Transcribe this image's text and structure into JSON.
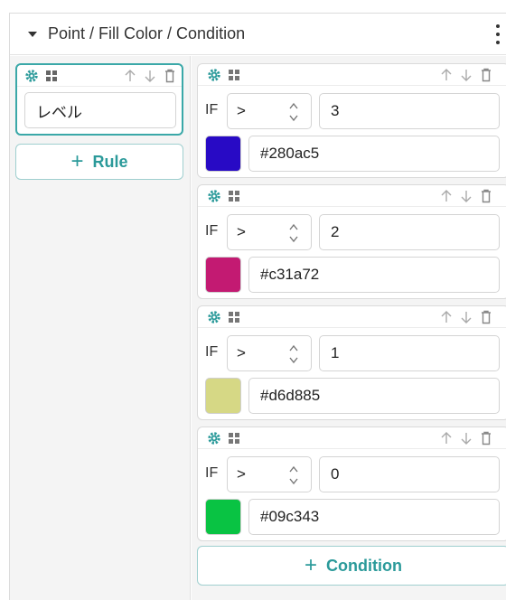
{
  "panel": {
    "title": "Point / Fill Color / Condition",
    "menu_icon": "kebab-menu-icon"
  },
  "rule": {
    "name": "レベル",
    "add_rule_label": "Rule"
  },
  "conditions": [
    {
      "if_label": "IF",
      "operator": ">",
      "value": "3",
      "color": "#280ac5"
    },
    {
      "if_label": "IF",
      "operator": ">",
      "value": "2",
      "color": "#c31a72"
    },
    {
      "if_label": "IF",
      "operator": ">",
      "value": "1",
      "color": "#d6d885"
    },
    {
      "if_label": "IF",
      "operator": ">",
      "value": "0",
      "color": "#09c343"
    }
  ],
  "add_condition_label": "Condition",
  "colors": {
    "accent": "#2b9a9a",
    "selected_border": "#3aa8a8"
  }
}
